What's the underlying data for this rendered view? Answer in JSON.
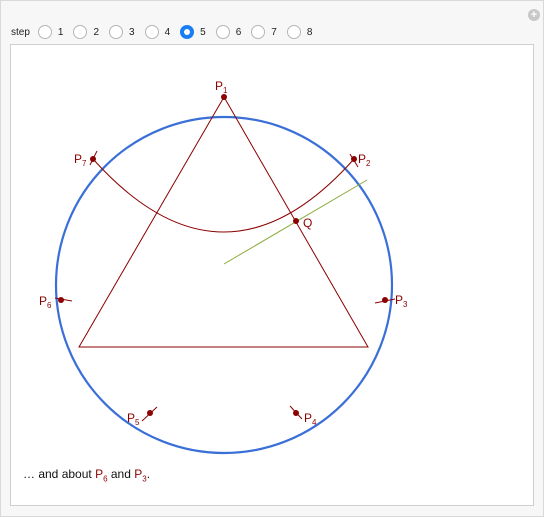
{
  "controls": {
    "label": "step",
    "options": [
      "1",
      "2",
      "3",
      "4",
      "5",
      "6",
      "7",
      "8"
    ],
    "selected": "5"
  },
  "diagram": {
    "points": [
      {
        "name": "P",
        "sub": "1"
      },
      {
        "name": "P",
        "sub": "2"
      },
      {
        "name": "P",
        "sub": "3"
      },
      {
        "name": "P",
        "sub": "4"
      },
      {
        "name": "P",
        "sub": "5"
      },
      {
        "name": "P",
        "sub": "6"
      },
      {
        "name": "P",
        "sub": "7"
      }
    ],
    "q_label": "Q",
    "colors": {
      "circle": "#3a6fd8",
      "lines": "#8b0000",
      "tangent": "#8aab3c"
    }
  },
  "caption": {
    "prefix": "… and about ",
    "p_a": "P",
    "p_a_sub": "6",
    "mid": " and ",
    "p_b": "P",
    "p_b_sub": "3",
    "suffix": "."
  }
}
